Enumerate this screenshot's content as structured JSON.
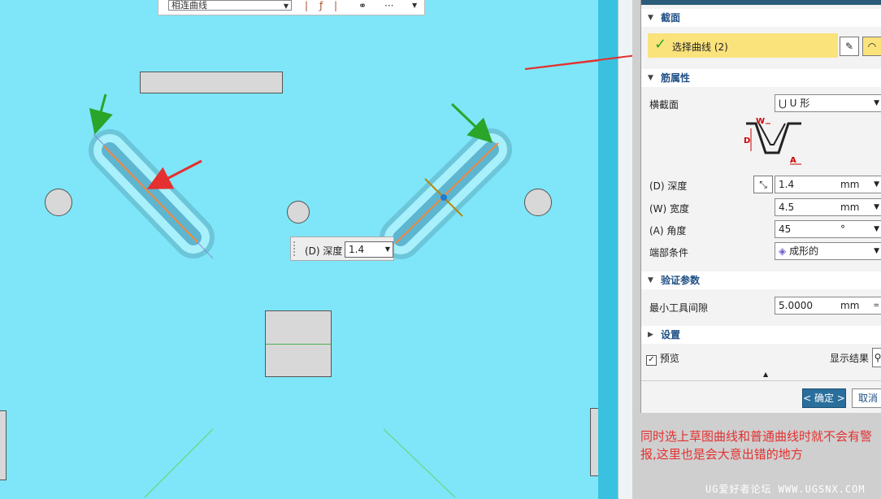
{
  "toolbar": {
    "select_value": "相连曲线",
    "more": "···"
  },
  "depth_popup": {
    "label": "(D) 深度",
    "value": "1.4"
  },
  "dialog": {
    "section_section": "截面",
    "select_curve": "选择曲线 (2)",
    "section_props": "筋属性",
    "cross_label": "横截面",
    "cross_value": "U 形",
    "diagram": {
      "w": "W",
      "d": "D",
      "a": "A"
    },
    "depth_label": "(D) 深度",
    "depth_value": "1.4",
    "depth_unit": "mm",
    "width_label": "(W) 宽度",
    "width_value": "4.5",
    "width_unit": "mm",
    "angle_label": "(A) 角度",
    "angle_value": "45",
    "angle_unit": "°",
    "end_label": "端部条件",
    "end_value": "成形的",
    "section_verify": "验证参数",
    "min_gap_label": "最小工具间隙",
    "min_gap_value": "5.0000",
    "min_gap_unit": "mm",
    "section_settings": "设置",
    "preview_label": "预览",
    "show_result": "显示结果",
    "ok": "< 确定 >",
    "cancel": "取消"
  },
  "annotation": "同时选上草图曲线和普通曲线时就不会有警报,这里也是会大意出错的地方",
  "watermark": "UG爱好者论坛 WWW.UGSNX.COM",
  "colors": {
    "viewport": "#7ee6f8",
    "highlight": "#fbe37c",
    "arrow_red": "#e53030",
    "arrow_green": "#2aa52a",
    "curve": "#f08a3c"
  }
}
